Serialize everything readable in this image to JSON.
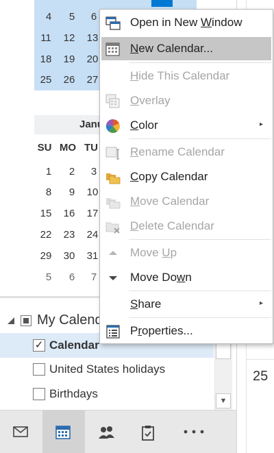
{
  "mini_calendar": {
    "top_weeks": [
      [
        "4",
        "5",
        "6"
      ],
      [
        "11",
        "12",
        "13"
      ],
      [
        "18",
        "19",
        "20"
      ],
      [
        "25",
        "26",
        "27"
      ]
    ],
    "month_label": "Janu",
    "day_headers": [
      "SU",
      "MO",
      "TU"
    ],
    "weeks": [
      [
        "1",
        "2",
        "3"
      ],
      [
        "8",
        "9",
        "10"
      ],
      [
        "15",
        "16",
        "17"
      ],
      [
        "22",
        "23",
        "24"
      ],
      [
        "29",
        "30",
        "31"
      ],
      [
        "5",
        "6",
        "7"
      ]
    ]
  },
  "folder_pane": {
    "group_label": "My Calend",
    "items": [
      {
        "label": "Calendar",
        "checked": "✓",
        "bold": true
      },
      {
        "label": "United States holidays",
        "checked": ""
      },
      {
        "label": "Birthdays",
        "checked": ""
      }
    ]
  },
  "nav_bar": {
    "items": [
      "mail-icon",
      "calendar-icon",
      "people-icon",
      "tasks-icon",
      "more-icon"
    ],
    "active": "calendar-icon"
  },
  "right_pane": {
    "date": "25"
  },
  "context_menu": {
    "items": [
      {
        "id": "open-new-window",
        "pre": "Open in New ",
        "u": "W",
        "post": "indow",
        "enabled": true
      },
      {
        "id": "new-calendar",
        "pre": "",
        "u": "N",
        "post": "ew Calendar...",
        "enabled": true,
        "highlighted": true
      },
      {
        "id": "hide-calendar",
        "pre": "",
        "u": "H",
        "post": "ide This Calendar",
        "enabled": false
      },
      {
        "id": "overlay",
        "pre": "",
        "u": "O",
        "post": "verlay",
        "enabled": false
      },
      {
        "id": "color",
        "pre": "",
        "u": "C",
        "post": "olor",
        "enabled": true,
        "submenu": true
      },
      {
        "id": "rename-calendar",
        "pre": "",
        "u": "R",
        "post": "ename Calendar",
        "enabled": false
      },
      {
        "id": "copy-calendar",
        "pre": "",
        "u": "C",
        "post": "opy Calendar",
        "enabled": true
      },
      {
        "id": "move-calendar",
        "pre": "",
        "u": "M",
        "post": "ove Calendar",
        "enabled": false
      },
      {
        "id": "delete-calendar",
        "pre": "",
        "u": "D",
        "post": "elete Calendar",
        "enabled": false
      },
      {
        "id": "move-up",
        "pre": "Move ",
        "u": "U",
        "post": "p",
        "enabled": false
      },
      {
        "id": "move-down",
        "pre": "Move Do",
        "u": "w",
        "post": "n",
        "enabled": true
      },
      {
        "id": "share",
        "pre": "",
        "u": "S",
        "post": "hare",
        "enabled": true,
        "submenu": true
      },
      {
        "id": "properties",
        "pre": "P",
        "u": "r",
        "post": "operties...",
        "enabled": true
      }
    ],
    "submenu_arrow": "▸"
  },
  "colors": {
    "selection": "#c7dff5",
    "today": "#0078d4",
    "menu_hover": "#c6c6c6",
    "disabled_text": "#a6a6a6",
    "accent": "#2b6cb0"
  }
}
